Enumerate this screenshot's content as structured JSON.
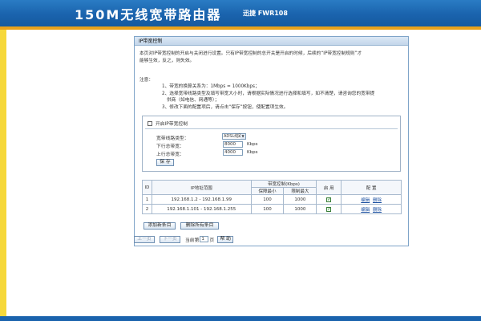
{
  "header": {
    "title": "150M无线宽带路由器",
    "subtitle": "迅捷 FWR108",
    "colors": {
      "header_blue": "#1a63ad",
      "stripe_orange": "#e9a21b",
      "left_strip_yellow": "#f6d83a"
    }
  },
  "panel": {
    "title": "IP带宽控制",
    "description": [
      "本页对IP带宽控制的开启与关闭进行设置。只有IP带宽控制的总开关是开启的时候，后续的“IP带宽控制规则”才",
      "能够生效，反之，则失效。"
    ],
    "note_heading": "注意：",
    "notes": [
      "1、带宽的换算关系为：1Mbps = 1000Kbps；",
      "2、选择宽带线路类型及填写带宽大小时，请根据实际情况进行选择和填写，如不清楚，请咨询您的宽带提",
      "供商（如电信、网通等）；",
      "3、修改下面的配置项后，请点击“保存”按钮，使配置项生效。"
    ]
  },
  "config": {
    "enable_label": "开启IP带宽控制",
    "line_type_label": "宽带线路类型：",
    "line_type_value": "ADSL线路",
    "down_label": "下行总带宽：",
    "down_value": "8000",
    "up_label": "上行总带宽：",
    "up_value": "4000",
    "unit": "Kbps",
    "save_label": "保 存"
  },
  "table": {
    "headers": {
      "id": "ID",
      "ip_range": "IP地址范围",
      "bandwidth": "带宽控制(Kbps)",
      "min": "保障最小",
      "max": "限制最大",
      "enable": "启 用",
      "config": "配 置"
    },
    "rows": [
      {
        "id": "1",
        "ip_range": "192.168.1.2 - 192.168.1.99",
        "min": "100",
        "max": "1000",
        "edit": "编辑",
        "delete": "删除"
      },
      {
        "id": "2",
        "ip_range": "192.168.1.101 - 192.168.1.255",
        "min": "100",
        "max": "1000",
        "edit": "编辑",
        "delete": "删除"
      }
    ]
  },
  "actions": {
    "add_label": "添加新条目",
    "delete_all_label": "删除所有条目"
  },
  "pager": {
    "prev_label": "上一页",
    "next_label": "下一页",
    "current_label": "当前第",
    "current_page": "1",
    "page_suffix": "页",
    "help_label": "帮 助"
  }
}
